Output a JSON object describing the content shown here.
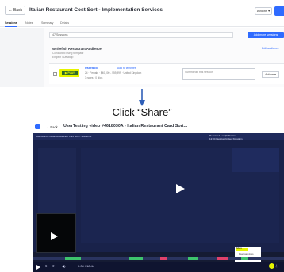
{
  "top": {
    "back_label": "Back",
    "title": "Italian Restaurant Cost Sort - Implementation Services",
    "actions_label": "Actions",
    "tabs": [
      "Sessions",
      "Notes",
      "Summary",
      "Details"
    ],
    "search_text": "47 Sessions",
    "add_button": "Add more sessions",
    "group_title": "Whitefish Restaurant Audience",
    "group_sub1": "Conducted using template",
    "group_sub2": "English / Desktop",
    "edit_link": "Edit audience",
    "row": {
      "play_label": "▶ PLAY",
      "name": "UserBob",
      "link": "Add to favorites",
      "meta": "24 · Female · $40,000 - $59,999 · United Kingdom",
      "meta2": "3 notes · 0 clips",
      "summarize_placeholder": "Summarize this session",
      "actions": "Actions"
    }
  },
  "caption": "Click “Share”",
  "bottom": {
    "back_label": "Back",
    "title": "UserTesting video #4618030A - Italian Restaurant Card Sort...",
    "bar_text": "Dashboard  ›  Italian Restaurant Card Sort  ›  Session 1",
    "stats": "Recorded  Length  Device",
    "stats2": "12:04  Desktop  United Kingdom",
    "share_menu": [
      "Share",
      "Download video",
      "Save to files"
    ],
    "time": "0:00 / 18:44"
  }
}
